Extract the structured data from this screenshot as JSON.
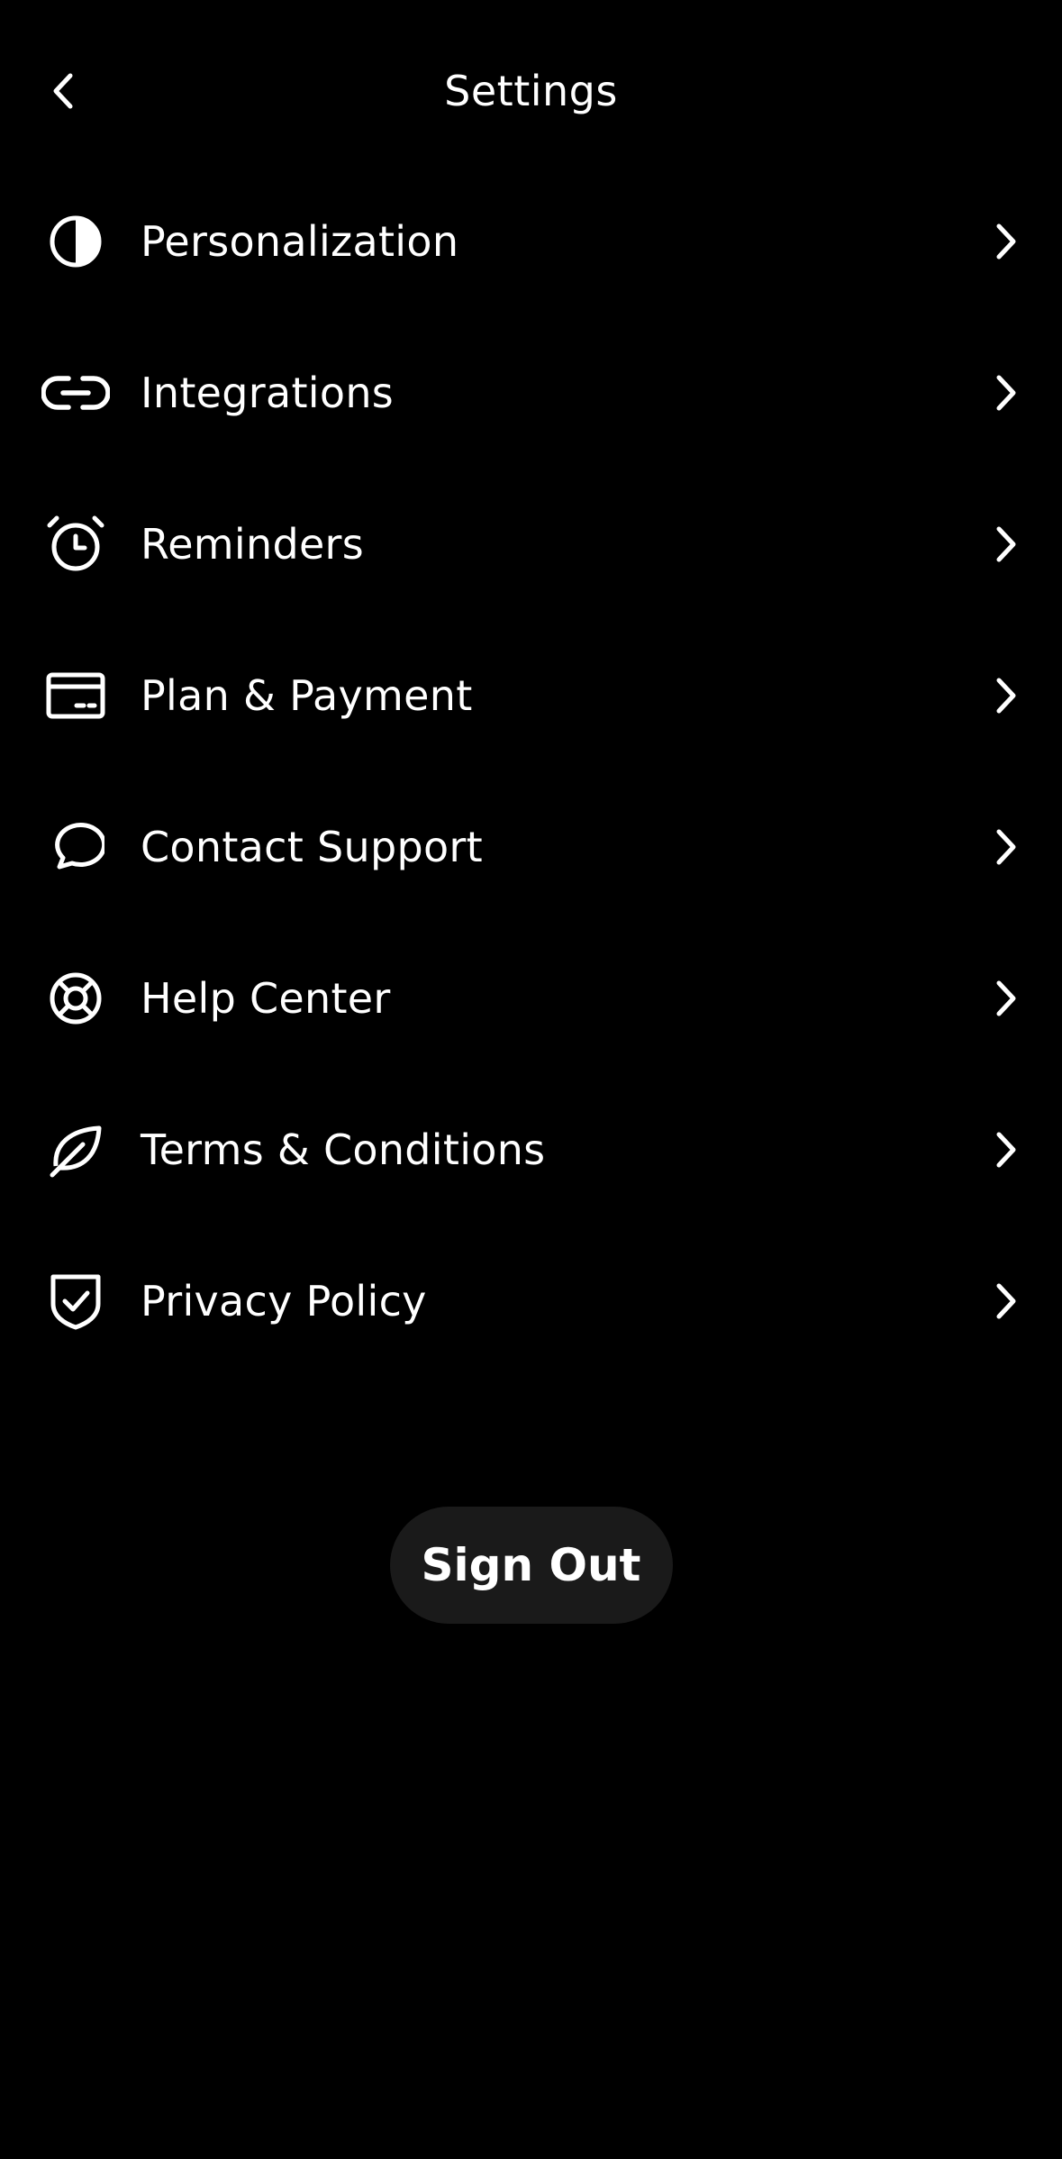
{
  "header": {
    "title": "Settings",
    "back_icon": "chevron-left-icon"
  },
  "menu": {
    "items": [
      {
        "label": "Personalization",
        "icon": "contrast-icon"
      },
      {
        "label": "Integrations",
        "icon": "link-icon"
      },
      {
        "label": "Reminders",
        "icon": "alarm-clock-icon"
      },
      {
        "label": "Plan & Payment",
        "icon": "credit-card-icon"
      },
      {
        "label": "Contact Support",
        "icon": "chat-bubble-icon"
      },
      {
        "label": "Help Center",
        "icon": "lifebuoy-icon"
      },
      {
        "label": "Terms & Conditions",
        "icon": "leaf-icon"
      },
      {
        "label": "Privacy Policy",
        "icon": "shield-check-icon"
      }
    ]
  },
  "footer": {
    "signout_label": "Sign Out"
  },
  "colors": {
    "background": "#000000",
    "text": "#ffffff",
    "button_bg": "#1a1a1a"
  }
}
